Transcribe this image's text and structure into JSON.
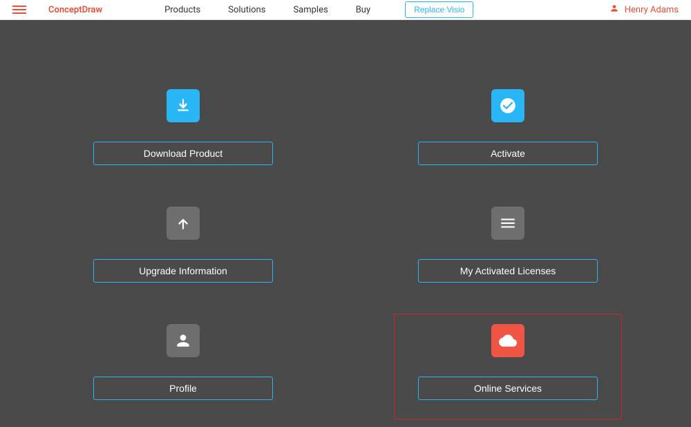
{
  "header": {
    "brand": "ConceptDraw",
    "nav": {
      "products": "Products",
      "solutions": "Solutions",
      "samples": "Samples",
      "buy": "Buy",
      "replace_visio": "Replace Visio"
    },
    "user": "Henry Adams"
  },
  "tiles": {
    "download": "Download Product",
    "activate": "Activate",
    "upgrade": "Upgrade Information",
    "licenses": "My Activated Licenses",
    "profile": "Profile",
    "online_services": "Online Services"
  },
  "colors": {
    "accent_blue": "#29b6f6",
    "accent_red": "#e84e35",
    "highlight": "#c62828",
    "tile_gray": "#6e6e6e",
    "tile_red": "#f05545",
    "bg": "#4a4a4a"
  }
}
